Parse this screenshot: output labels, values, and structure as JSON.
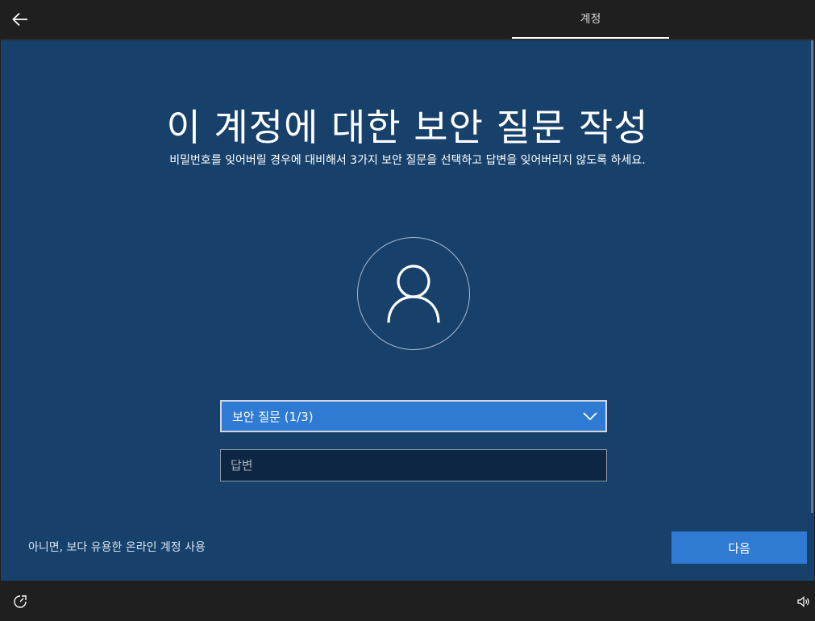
{
  "header": {
    "tab_label": "계정"
  },
  "main": {
    "title": "이 계정에 대한 보안 질문 작성",
    "subtitle": "비밀번호를 잊어버릴 경우에 대비해서 3가지 보안 질문을 선택하고 답변을 잊어버리지 않도록 하세요.",
    "question_select": {
      "value": "보안 질문 (1/3)"
    },
    "answer_field": {
      "placeholder": "답변",
      "value": ""
    },
    "online_link": "아니면, 보다 유용한 온라인 계정 사용",
    "next_button": "다음"
  },
  "icons": {
    "back": "back-arrow-icon",
    "avatar": "user-icon",
    "dropdown": "chevron-down-icon",
    "ease_of_access": "ease-of-access-icon",
    "volume": "volume-icon"
  },
  "colors": {
    "background": "#17406b",
    "accent": "#2f7bd3",
    "bar": "#1f1f1f"
  }
}
